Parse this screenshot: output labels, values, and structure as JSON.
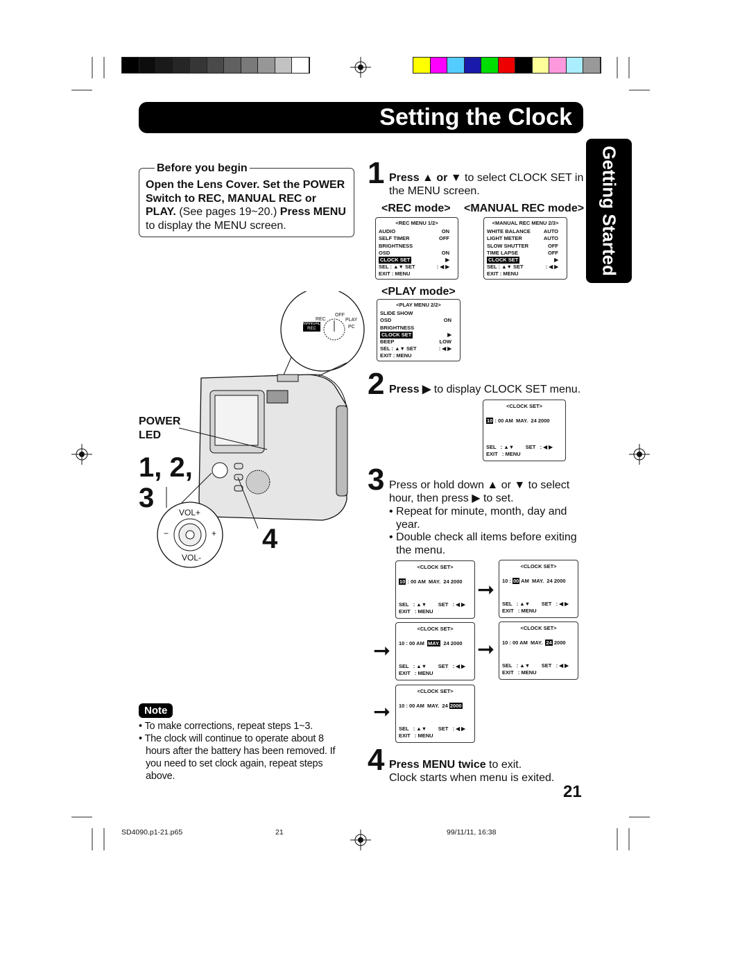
{
  "header": {
    "title": "Setting the Clock",
    "side_tab": "Getting Started"
  },
  "color_bars": {
    "gray": [
      "#000000",
      "#0d0d0d",
      "#1a1a1a",
      "#262626",
      "#363636",
      "#4a4a4a",
      "#606060",
      "#7a7a7a",
      "#979797",
      "#c2c2c2",
      "#ffffff"
    ],
    "color": [
      "#ffff00",
      "#ff00ff",
      "#55ccff",
      "#1a1aaa",
      "#00dd00",
      "#ee0000",
      "#000000",
      "#ffff99",
      "#ff99dd",
      "#aaeeff",
      "#999999"
    ]
  },
  "before": {
    "legend": "Before you begin",
    "bold": "Open the Lens Cover. Set the POWER Switch to REC, MANUAL REC or PLAY.",
    "text1": "(See pages 19~20.) ",
    "bold2": "Press MENU",
    "text2": " to display the MENU screen."
  },
  "camera": {
    "power_led": "POWER LED",
    "step_label": "1, 2, 3",
    "step4": "4",
    "vol_plus": "VOL+",
    "vol_minus": "VOL-",
    "minus": "−",
    "plus": "+",
    "dial": {
      "rec": "REC",
      "off": "OFF",
      "play": "PLAY",
      "pc": "PC",
      "manual_rec": "MANUAL REC"
    }
  },
  "step1": {
    "num": "1",
    "bold": "Press ▲ or ▼",
    "text": " to select CLOCK SET in the MENU screen.",
    "rec_mode": "<REC mode>",
    "manual_mode": "<MANUAL REC mode>",
    "play_mode": "<PLAY mode>"
  },
  "menus": [
    {
      "title": "<REC MENU 1/2>",
      "rows": [
        [
          "AUDIO",
          "ON"
        ],
        [
          "SELF TIMER",
          "OFF"
        ],
        [
          "BRIGHTNESS",
          ""
        ],
        [
          "OSD",
          "ON"
        ],
        [
          "CLOCK SET",
          "▶"
        ],
        [
          "SEL   : ▲▼      SET",
          "  : ◀ ▶"
        ],
        [
          "EXIT   : MENU",
          ""
        ]
      ],
      "hl": 4
    },
    {
      "title": "<MANUAL REC MENU 2/3>",
      "rows": [
        [
          "WHITE BALANCE",
          "AUTO"
        ],
        [
          "LIGHT METER",
          "AUTO"
        ],
        [
          "SLOW SHUTTER",
          "OFF"
        ],
        [
          "TIME LAPSE",
          "OFF"
        ],
        [
          "CLOCK SET",
          "▶"
        ],
        [
          "SEL   : ▲▼      SET",
          "  : ◀ ▶"
        ],
        [
          "EXIT   : MENU",
          ""
        ]
      ],
      "hl": 4
    },
    {
      "title": "<PLAY MENU 2/2>",
      "rows": [
        [
          "SLIDE SHOW",
          ""
        ],
        [
          "OSD",
          "ON"
        ],
        [
          "BRIGHTNESS",
          ""
        ],
        [
          "CLOCK SET",
          "▶"
        ],
        [
          "BEEP",
          "LOW"
        ],
        [
          "SEL   : ▲▼      SET",
          "  : ◀ ▶"
        ],
        [
          "EXIT   : MENU",
          ""
        ]
      ],
      "hl": 3
    }
  ],
  "step2": {
    "num": "2",
    "bold": "Press ▶",
    "text": " to display CLOCK SET menu."
  },
  "step3": {
    "num": "3",
    "text": "Press or hold down ▲ or ▼ to select hour, then press ▶ to set.",
    "bullet1": "• Repeat for minute, month, day and year.",
    "bullet2": "• Double check all items before exiting the menu."
  },
  "clock_screens": {
    "title": "<CLOCK SET>",
    "sel": "SEL   : ▲▼        SET   : ◀ ▶",
    "exit": "EXIT   : MENU",
    "segments": [
      "10",
      " : ",
      "00",
      " ",
      "AM",
      "  ",
      "MAY.",
      "  ",
      "24",
      " ",
      "2000"
    ],
    "highlights": [
      0,
      0,
      2,
      6,
      8,
      10
    ]
  },
  "step4": {
    "num": "4",
    "bold": "Press MENU twice",
    "text": " to exit.",
    "text2": "Clock starts when menu is exited."
  },
  "note": {
    "label": "Note",
    "items": [
      "To make corrections, repeat steps 1~3.",
      "The clock will continue to operate about 8 hours after the battery has been removed. If you need to set clock again, repeat steps above."
    ]
  },
  "page_number": "21",
  "footer": {
    "file": "SD4090.p1-21.p65",
    "page": "21",
    "date": "99/11/11, 16:38"
  }
}
